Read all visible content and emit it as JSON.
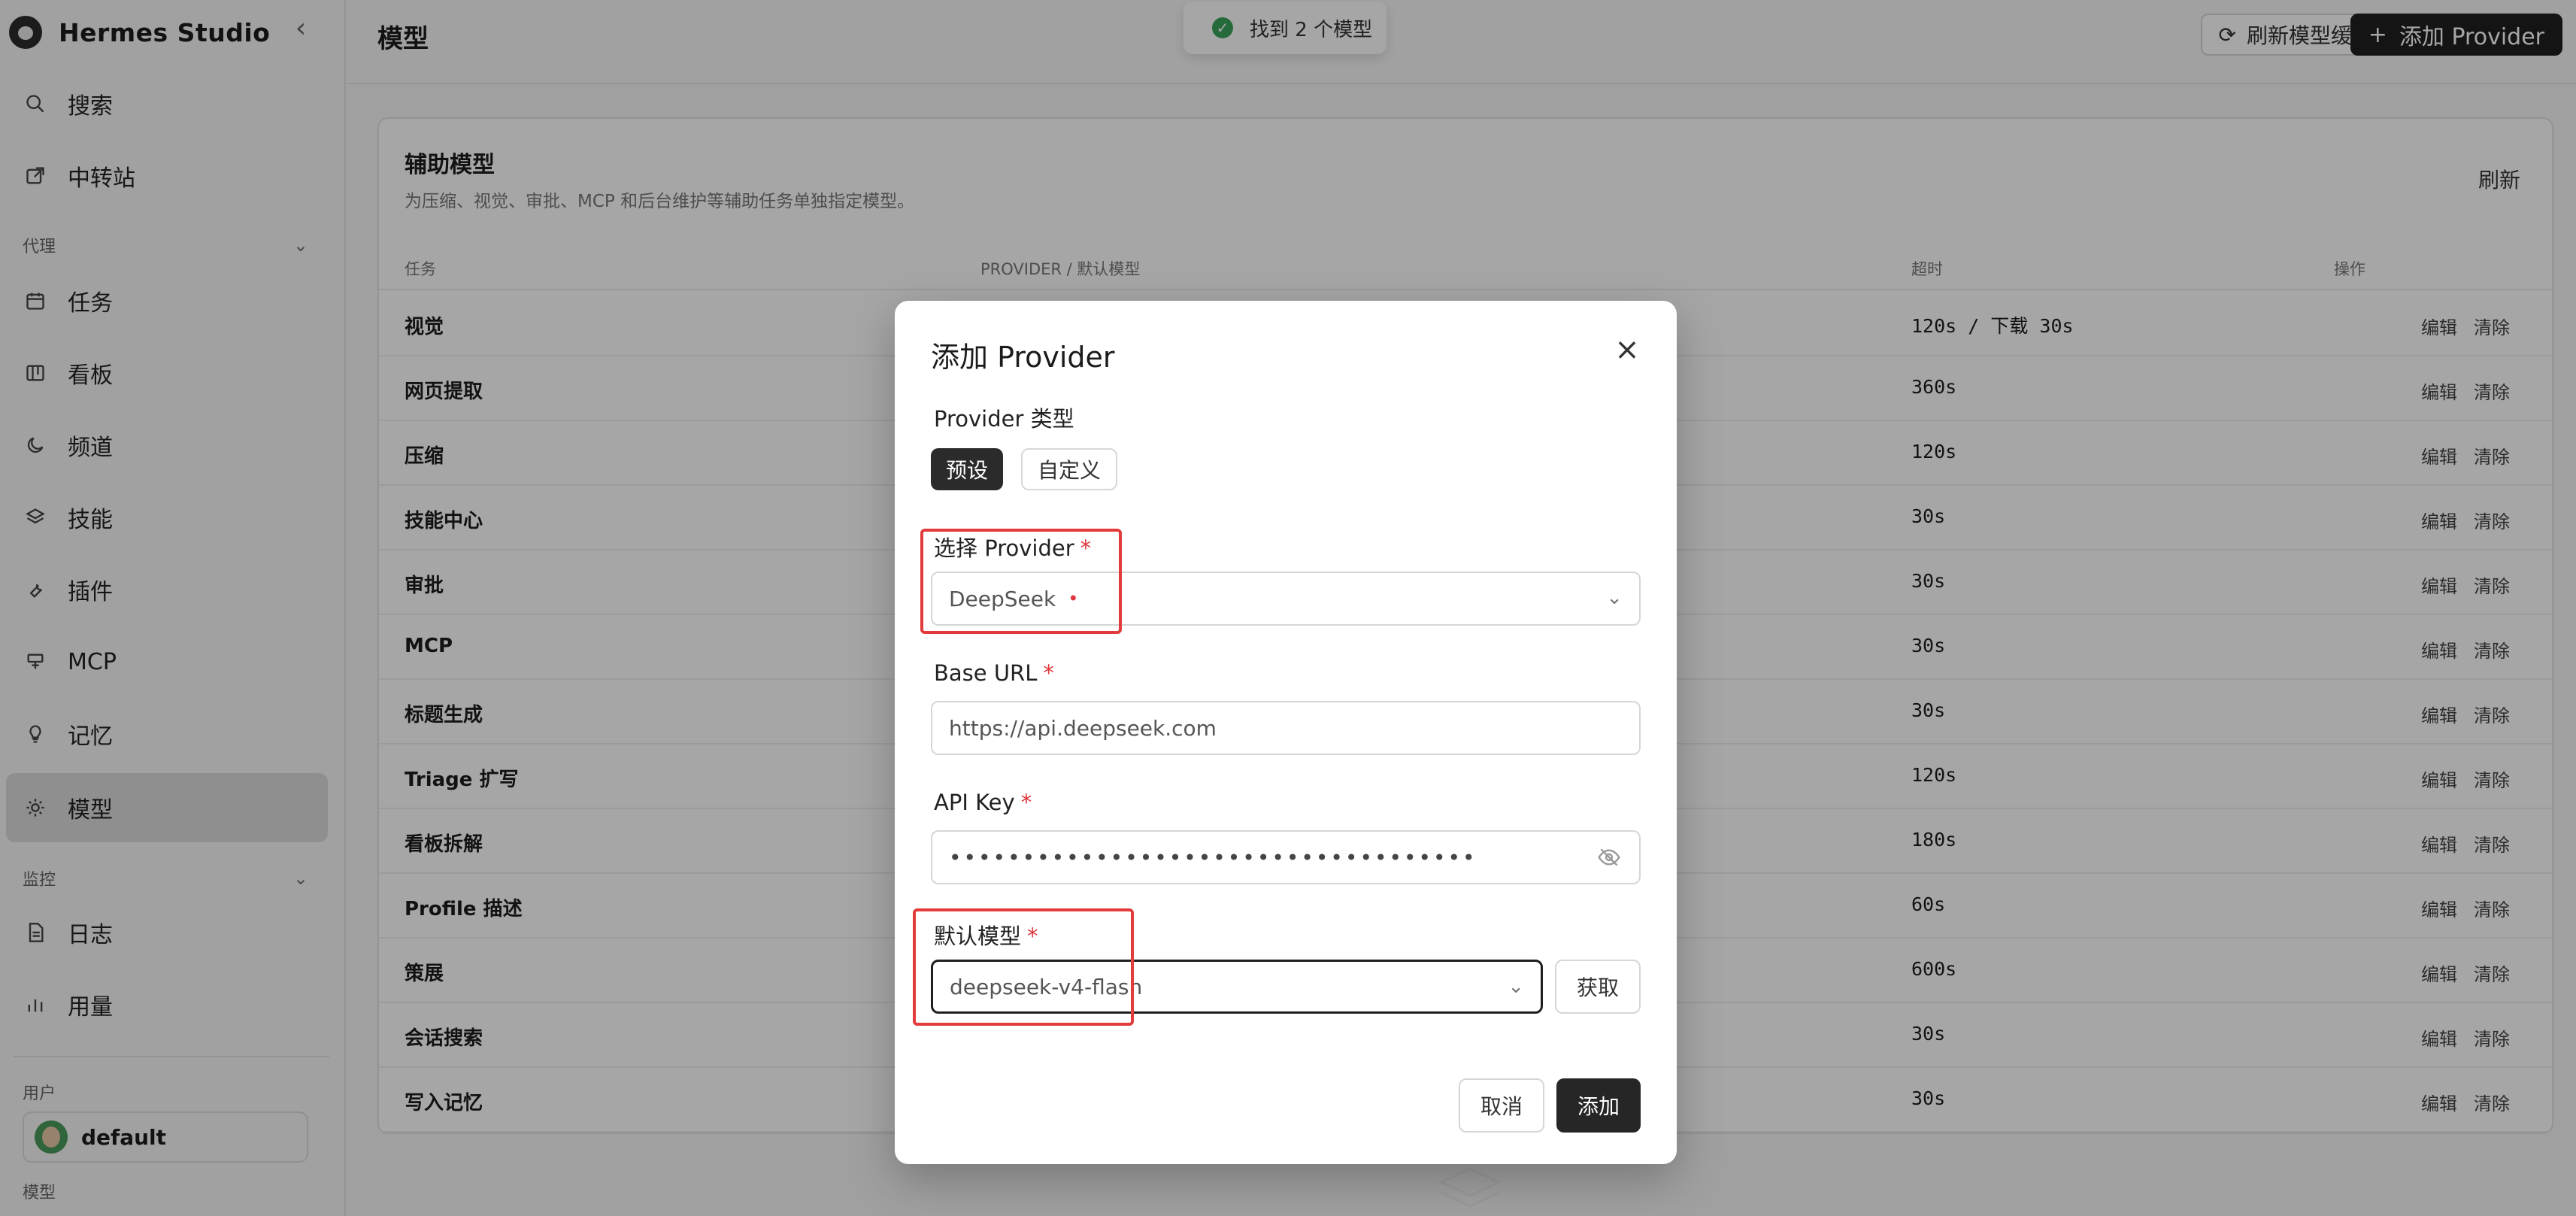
{
  "app": {
    "name": "Hermes Studio"
  },
  "sidebar": {
    "items_top": [
      {
        "label": "搜索",
        "icon": "search-icon"
      },
      {
        "label": "中转站",
        "icon": "external-link-icon"
      }
    ],
    "section_agent": "代理",
    "items_agent": [
      {
        "label": "任务",
        "icon": "calendar-icon"
      },
      {
        "label": "看板",
        "icon": "kanban-icon"
      },
      {
        "label": "频道",
        "icon": "moon-icon"
      },
      {
        "label": "技能",
        "icon": "layers-icon"
      },
      {
        "label": "插件",
        "icon": "wrench-icon"
      },
      {
        "label": "MCP",
        "icon": "plug-icon"
      },
      {
        "label": "记忆",
        "icon": "lightbulb-icon"
      },
      {
        "label": "模型",
        "icon": "sun-icon"
      }
    ],
    "section_monitor": "监控",
    "items_monitor": [
      {
        "label": "日志",
        "icon": "file-icon"
      },
      {
        "label": "用量",
        "icon": "bar-chart-icon"
      }
    ],
    "user_section": "用户",
    "user_name": "default",
    "model_section": "模型"
  },
  "header": {
    "title": "模型",
    "refresh_cache": "刷新模型缓存",
    "add_provider": "添加 Provider",
    "toast": "找到 2 个模型"
  },
  "card": {
    "title": "辅助模型",
    "desc": "为压缩、视觉、审批、MCP 和后台维护等辅助任务单独指定模型。",
    "refresh": "刷新",
    "columns": {
      "task": "任务",
      "provider": "PROVIDER / 默认模型",
      "timeout": "超时",
      "action": "操作"
    },
    "edit_label": "编辑",
    "clear_label": "清除",
    "rows": [
      {
        "task": "视觉",
        "timeout": "120s / 下载 30s"
      },
      {
        "task": "网页提取",
        "timeout": "360s"
      },
      {
        "task": "压缩",
        "timeout": "120s"
      },
      {
        "task": "技能中心",
        "timeout": "30s"
      },
      {
        "task": "审批",
        "timeout": "30s"
      },
      {
        "task": "MCP",
        "timeout": "30s"
      },
      {
        "task": "标题生成",
        "timeout": "30s"
      },
      {
        "task": "Triage 扩写",
        "timeout": "120s"
      },
      {
        "task": "看板拆解",
        "timeout": "180s"
      },
      {
        "task": "Profile 描述",
        "timeout": "60s"
      },
      {
        "task": "策展",
        "timeout": "600s"
      },
      {
        "task": "会话搜索",
        "timeout": "30s"
      },
      {
        "task": "写入记忆",
        "timeout": "30s"
      }
    ]
  },
  "modal": {
    "title": "添加 Provider",
    "provider_type_label": "Provider 类型",
    "type_preset": "预设",
    "type_custom": "自定义",
    "select_provider_label": "选择 Provider",
    "selected_provider": "DeepSeek",
    "base_url_label": "Base URL",
    "base_url_value": "https://api.deepseek.com",
    "api_key_label": "API Key",
    "api_key_masked": "••••••••••••••••••••••••••••••••••••",
    "default_model_label": "默认模型",
    "default_model_value": "deepseek-v4-flash",
    "fetch": "获取",
    "cancel": "取消",
    "add": "添加",
    "required_mark": "*"
  },
  "colors": {
    "highlight": "#e23b3b",
    "primary": "#1f1f1f",
    "required": "#e0383e"
  }
}
